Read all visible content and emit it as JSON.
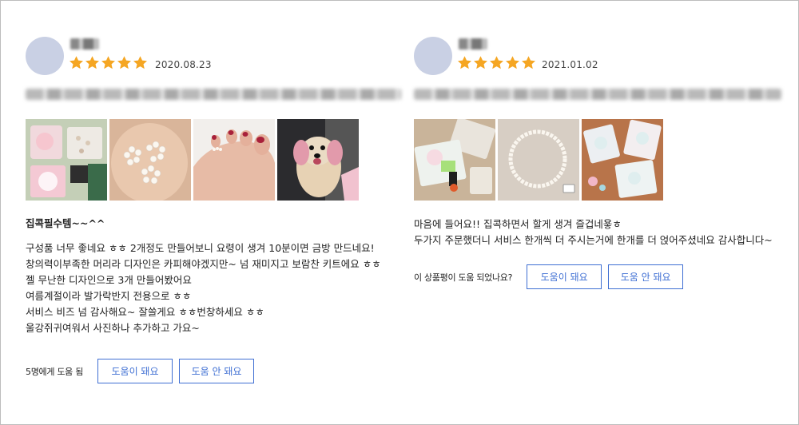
{
  "reviews": [
    {
      "rating": 5,
      "date": "2020.08.23",
      "title": "집콕필수템~~^^",
      "lines": [
        "구성품 너무 좋네요 ㅎㅎ 2개정도 만들어보니 요령이 생겨 10분이면 금방 만드네요!",
        "창의력이부족한 머리라 디자인은 카피해야겠지만~ 넘 재미지고 보람찬 키트에요 ㅎㅎ",
        "젤 무난한 디자인으로 3개 만들어봤어요",
        "여름계절이라 발가락반지 전용으로 ㅎㅎ",
        "서비스 비즈 넘 감사해요~ 잘쓸게요 ㅎㅎ번창하세요 ㅎㅎ",
        "울강쥐귀여워서 사진하나 추가하고 가요~"
      ],
      "helpful_text": "5명에게 도움 됨",
      "helpful_button": "도움이 돼요",
      "not_helpful_button": "도움 안 돼요",
      "photos": [
        "kit-package-photo",
        "pearl-rings-in-hand-photo",
        "toe-ring-on-foot-photo",
        "puppy-photo"
      ]
    },
    {
      "rating": 5,
      "date": "2021.01.02",
      "title": "",
      "lines": [
        "마음에 들어요!! 집콕하면서 할게 생겨 즐겁네욯ㅎ",
        "두가지 주문했더니 서비스 한개씩 더 주시는거에 한개를 더 얹어주셨네요 감사합니다~"
      ],
      "helpful_text": "이 상품평이 도움 되었나요?",
      "helpful_button": "도움이 돼요",
      "not_helpful_button": "도움 안 돼요",
      "photos": [
        "kit-contents-photo",
        "pearl-necklace-photo",
        "bead-packets-photo"
      ]
    }
  ],
  "colors": {
    "star": "#f5a623",
    "button_border": "#3f6fd3",
    "avatar": "#c9d0e4"
  }
}
